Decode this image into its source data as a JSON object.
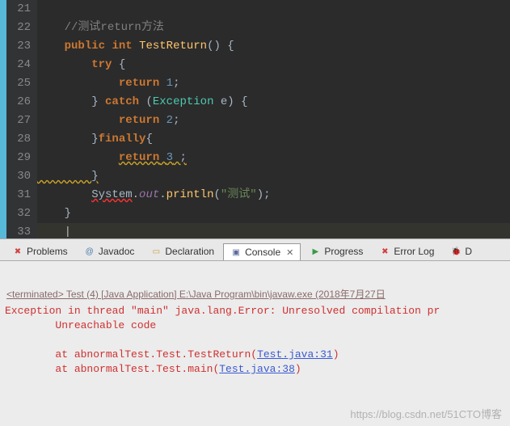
{
  "gutter": {
    "lines": [
      "21",
      "22",
      "23",
      "24",
      "25",
      "26",
      "27",
      "28",
      "29",
      "30",
      "31",
      "32",
      "33"
    ]
  },
  "code": {
    "l21": "",
    "l22_indent": "    ",
    "l22_comment": "//测试return方法",
    "l23_indent": "    ",
    "l23_kw_public": "public",
    "l23_sp1": " ",
    "l23_kw_int": "int",
    "l23_sp2": " ",
    "l23_method": "TestReturn",
    "l23_rest": "() {",
    "l24_indent": "        ",
    "l24_kw": "try",
    "l24_rest": " {",
    "l25_indent": "            ",
    "l25_kw": "return",
    "l25_sp": " ",
    "l25_num": "1",
    "l25_semi": ";",
    "l26_indent": "        ",
    "l26_brace": "} ",
    "l26_kw": "catch",
    "l26_sp": " (",
    "l26_type": "Exception",
    "l26_sp2": " ",
    "l26_var": "e",
    "l26_rest": ") {",
    "l27_indent": "            ",
    "l27_kw": "return",
    "l27_sp": " ",
    "l27_num": "2",
    "l27_semi": ";",
    "l28_indent": "        ",
    "l28_brace": "}",
    "l28_kw": "finally",
    "l28_rest": "{",
    "l29_indent": "            ",
    "l29_kw": "return",
    "l29_sp": " ",
    "l29_num": "3",
    "l29_semi": " ;",
    "l30_indent": "        ",
    "l30_brace": "}",
    "l31_indent": "        ",
    "l31_sys": "System",
    "l31_dot1": ".",
    "l31_out": "out",
    "l31_dot2": ".",
    "l31_println": "println",
    "l31_open": "(",
    "l31_str": "\"测试\"",
    "l31_close": ")",
    "l31_semi": ";",
    "l32_indent": "    ",
    "l32_brace": "}",
    "l33_indent": "    ",
    "l33_cursor": "|"
  },
  "tabs": {
    "problems": "Problems",
    "javadoc": "Javadoc",
    "declaration": "Declaration",
    "console": "Console",
    "progress": "Progress",
    "errorlog": "Error Log",
    "debug": "D"
  },
  "console": {
    "title": "<terminated> Test (4) [Java Application] E:\\Java Program\\bin\\javaw.exe (2018年7月27日",
    "line1": "Exception in thread \"main\" java.lang.Error: Unresolved compilation pr",
    "line2": "        Unreachable code",
    "line3": "",
    "line4_a": "        at abnormalTest.Test.TestReturn(",
    "line4_link": "Test.java:31",
    "line4_b": ")",
    "line5_a": "        at abnormalTest.Test.main(",
    "line5_link": "Test.java:38",
    "line5_b": ")"
  },
  "watermark": "https://blog.csdn.net/51CTO博客"
}
